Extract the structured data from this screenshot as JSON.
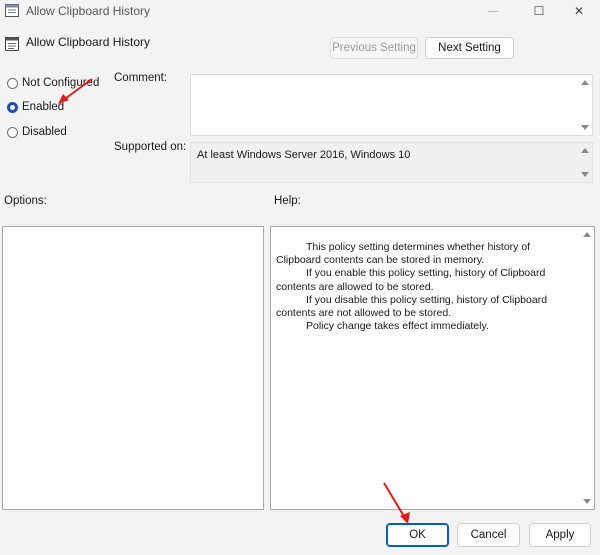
{
  "window": {
    "title": "Allow Clipboard History",
    "minimize_glyph": "—",
    "maximize_glyph": "☐",
    "close_glyph": "✕"
  },
  "header": {
    "policy_name": "Allow Clipboard History",
    "icon": "policy-setting-icon"
  },
  "nav": {
    "previous_label": "Previous Setting",
    "next_label": "Next Setting"
  },
  "state": {
    "options": [
      {
        "label": "Not Configured",
        "checked": false
      },
      {
        "label": "Enabled",
        "checked": true
      },
      {
        "label": "Disabled",
        "checked": false
      }
    ]
  },
  "comment": {
    "label": "Comment:",
    "value": ""
  },
  "supported": {
    "label": "Supported on:",
    "value": "At least Windows Server 2016, Windows 10"
  },
  "options_section": {
    "label": "Options:"
  },
  "help_section": {
    "label": "Help:",
    "paragraphs": [
      "This policy setting determines whether history of Clipboard contents can be stored in memory.",
      "If you enable this policy setting, history of Clipboard contents are allowed to be stored.",
      "If you disable this policy setting, history of Clipboard contents are not allowed to be stored.",
      "Policy change takes effect immediately."
    ]
  },
  "footer": {
    "ok_label": "OK",
    "cancel_label": "Cancel",
    "apply_label": "Apply"
  },
  "colors": {
    "annotation_arrow": "#e01b1b",
    "radio_selected": "#1a4fb5",
    "default_button_border": "#005fb8"
  }
}
